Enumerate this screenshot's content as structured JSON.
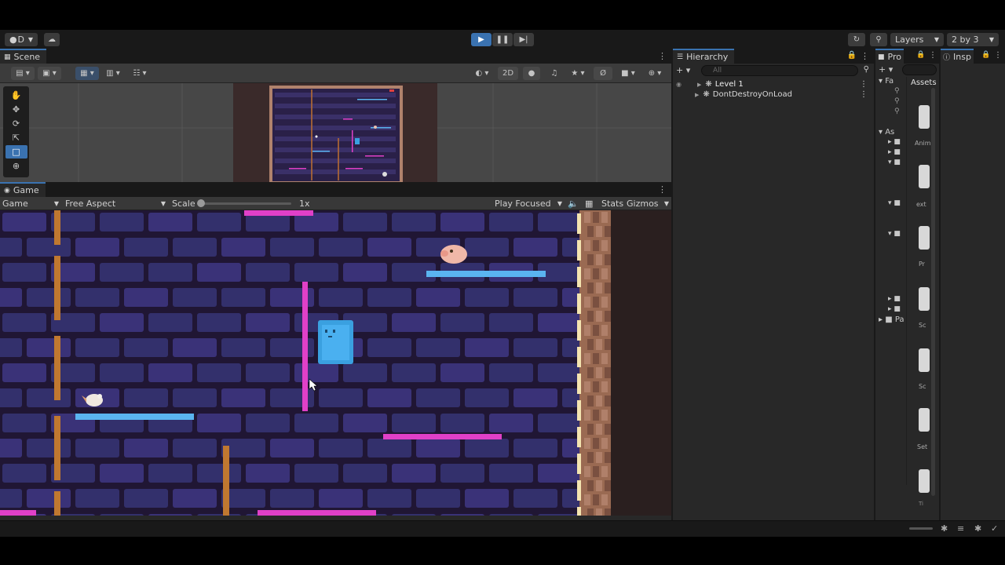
{
  "toolbar": {
    "account_label": "D",
    "layers_label": "Layers",
    "layout_label": "2 by 3"
  },
  "scene": {
    "tab_label": "Scene",
    "mode_2d_label": "2D"
  },
  "game": {
    "tab_label": "Game",
    "display_label": "Game",
    "aspect_label": "Free Aspect",
    "scale_label": "Scale",
    "scale_value": "1x",
    "scale_level": 0,
    "play_mode_label": "Play Focused",
    "stats_label": "Stats",
    "gizmos_label": "Gizmos"
  },
  "hierarchy": {
    "tab_label": "Hierarchy",
    "search_placeholder": "All",
    "items": [
      {
        "label": "Level 1"
      },
      {
        "label": "DontDestroyOnLoad"
      }
    ]
  },
  "project": {
    "tab_label": "Pro",
    "assets_header": "Assets",
    "tree": [
      "Fa",
      "As",
      "Pa"
    ],
    "asset_labels": [
      "Anim",
      "ext",
      "Pr",
      "Sc",
      "Sc",
      "Set",
      "Ti"
    ]
  },
  "inspector": {
    "tab_label": "Insp"
  },
  "colors": {
    "accent": "#3a72b0",
    "magenta_platform": "#e040c8",
    "cyan_platform": "#5ab4f0",
    "brick_bg": "#201634",
    "player": "#3aa0e0"
  }
}
